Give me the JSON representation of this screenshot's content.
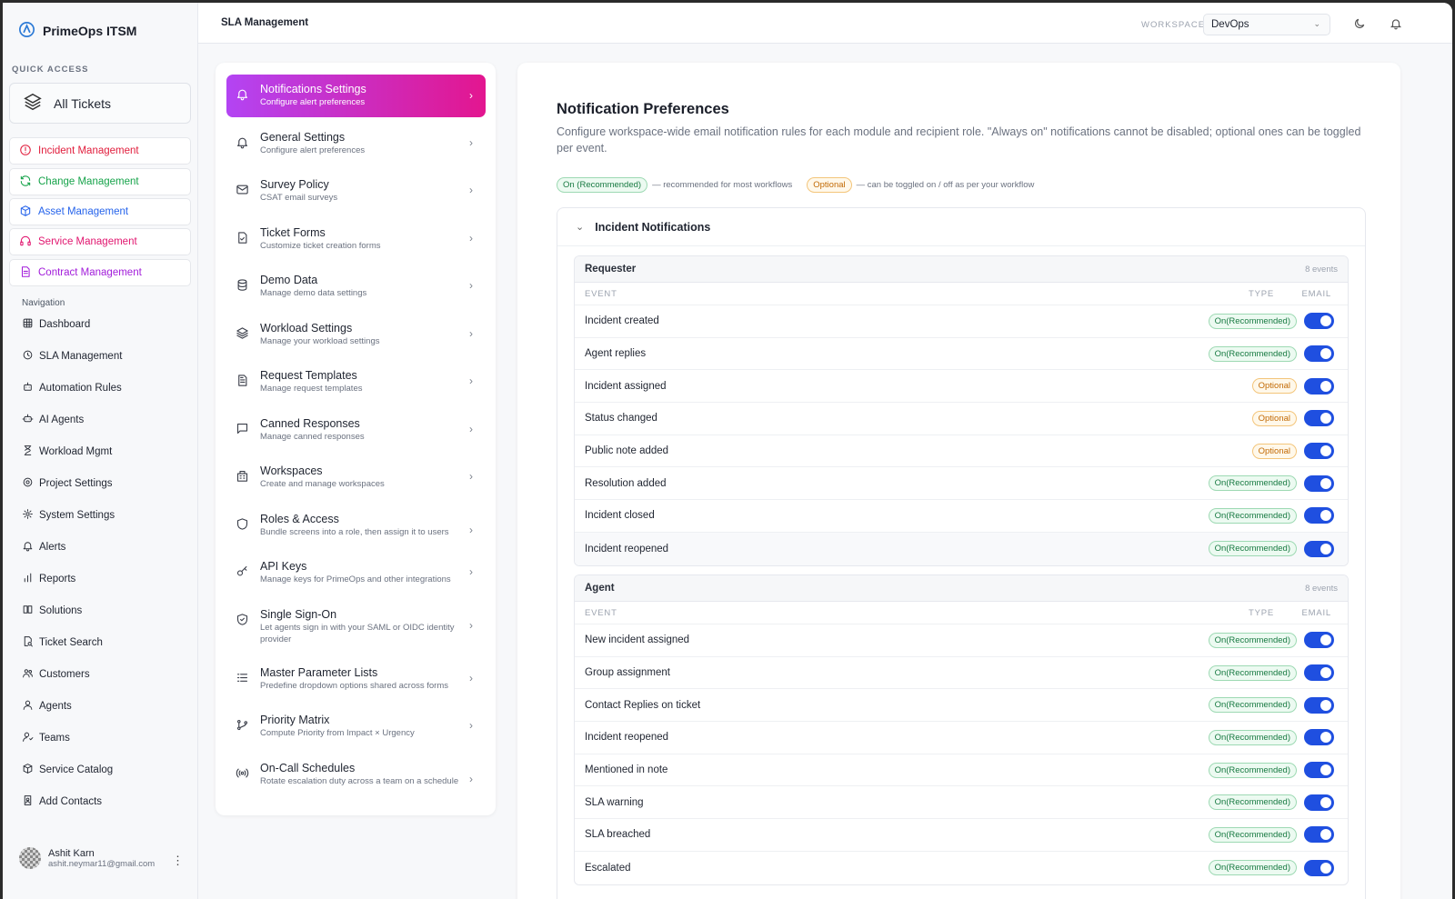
{
  "app": {
    "name": "PrimeOps ITSM"
  },
  "sidebar": {
    "quick_access_label": "QUICK ACCESS",
    "all_tickets_label": "All Tickets",
    "modules": [
      {
        "label": "Incident Management",
        "color": "#e11d3c",
        "icon": "alert-circle-icon"
      },
      {
        "label": "Change Management",
        "color": "#16a34a",
        "icon": "refresh-icon"
      },
      {
        "label": "Asset Management",
        "color": "#2563eb",
        "icon": "cube-icon"
      },
      {
        "label": "Service Management",
        "color": "#e1166f",
        "icon": "headset-icon"
      },
      {
        "label": "Contract Management",
        "color": "#a21cda",
        "icon": "document-icon"
      }
    ],
    "nav_label": "Navigation",
    "nav_items": [
      {
        "label": "Dashboard",
        "icon": "grid-icon"
      },
      {
        "label": "SLA Management",
        "icon": "clock-icon"
      },
      {
        "label": "Automation Rules",
        "icon": "robot-icon"
      },
      {
        "label": "AI Agents",
        "icon": "bot-icon"
      },
      {
        "label": "Workload Mgmt",
        "icon": "hourglass-icon"
      },
      {
        "label": "Project Settings",
        "icon": "gear-icon"
      },
      {
        "label": "System Settings",
        "icon": "cog-icon"
      },
      {
        "label": "Alerts",
        "icon": "bell-icon"
      },
      {
        "label": "Reports",
        "icon": "bar-chart-icon"
      },
      {
        "label": "Solutions",
        "icon": "book-icon"
      },
      {
        "label": "Ticket Search",
        "icon": "file-search-icon"
      },
      {
        "label": "Customers",
        "icon": "users-icon"
      },
      {
        "label": "Agents",
        "icon": "user-icon"
      },
      {
        "label": "Teams",
        "icon": "user-group-icon"
      },
      {
        "label": "Service Catalog",
        "icon": "box-icon"
      },
      {
        "label": "Add Contacts",
        "icon": "contact-icon"
      }
    ],
    "user": {
      "name": "Ashit Karn",
      "email": "ashit.neymar11@gmail.com"
    }
  },
  "topbar": {
    "title": "SLA Management",
    "workspace_label": "WORKSPACE",
    "workspace_value": "DevOps"
  },
  "settings_menu": [
    {
      "title": "Notifications Settings",
      "subtitle": "Configure alert preferences",
      "icon": "bell-icon",
      "active": true
    },
    {
      "title": "General Settings",
      "subtitle": "Configure alert preferences",
      "icon": "bell-icon"
    },
    {
      "title": "Survey Policy",
      "subtitle": "CSAT email surveys",
      "icon": "mail-icon"
    },
    {
      "title": "Ticket Forms",
      "subtitle": "Customize ticket creation forms",
      "icon": "form-icon"
    },
    {
      "title": "Demo Data",
      "subtitle": "Manage demo data settings",
      "icon": "database-icon"
    },
    {
      "title": "Workload Settings",
      "subtitle": "Manage your workload settings",
      "icon": "layers-icon"
    },
    {
      "title": "Request Templates",
      "subtitle": "Manage request templates",
      "icon": "file-text-icon"
    },
    {
      "title": "Canned Responses",
      "subtitle": "Manage canned responses",
      "icon": "message-icon"
    },
    {
      "title": "Workspaces",
      "subtitle": "Create and manage workspaces",
      "icon": "building-icon"
    },
    {
      "title": "Roles & Access",
      "subtitle": "Bundle screens into a role, then assign it to users",
      "icon": "shield-icon"
    },
    {
      "title": "API Keys",
      "subtitle": "Manage keys for PrimeOps and other integrations",
      "icon": "key-icon"
    },
    {
      "title": "Single Sign-On",
      "subtitle": "Let agents sign in with your SAML or OIDC identity provider",
      "icon": "shield-check-icon"
    },
    {
      "title": "Master Parameter Lists",
      "subtitle": "Predefine dropdown options shared across forms",
      "icon": "list-icon"
    },
    {
      "title": "Priority Matrix",
      "subtitle": "Compute Priority from Impact × Urgency",
      "icon": "branch-icon"
    },
    {
      "title": "On-Call Schedules",
      "subtitle": "Rotate escalation duty across a team on a schedule",
      "icon": "broadcast-icon"
    }
  ],
  "main": {
    "title": "Notification Preferences",
    "description": "Configure workspace-wide email notification rules for each module and recipient role. \"Always on\" notifications cannot be disabled; optional ones can be toggled per event.",
    "legend": {
      "on_pill": "On (Recommended)",
      "on_text": "— recommended for most workflows",
      "optional_pill": "Optional",
      "optional_text": "— can be toggled on / off as per your workflow"
    },
    "section_title": "Incident Notifications",
    "col_event": "EVENT",
    "col_type": "TYPE",
    "col_email": "EMAIL",
    "groups": [
      {
        "name": "Requester",
        "count": "8 events",
        "rows": [
          {
            "event": "Incident created",
            "type": "On(Recommended)",
            "kind": "on",
            "email": true
          },
          {
            "event": "Agent replies",
            "type": "On(Recommended)",
            "kind": "on",
            "email": true
          },
          {
            "event": "Incident assigned",
            "type": "Optional",
            "kind": "opt",
            "email": true
          },
          {
            "event": "Status changed",
            "type": "Optional",
            "kind": "opt",
            "email": true
          },
          {
            "event": "Public note added",
            "type": "Optional",
            "kind": "opt",
            "email": true
          },
          {
            "event": "Resolution added",
            "type": "On(Recommended)",
            "kind": "on",
            "email": true
          },
          {
            "event": "Incident closed",
            "type": "On(Recommended)",
            "kind": "on",
            "email": true
          },
          {
            "event": "Incident reopened",
            "type": "On(Recommended)",
            "kind": "on",
            "email": true
          }
        ]
      },
      {
        "name": "Agent",
        "count": "8 events",
        "rows": [
          {
            "event": "New incident assigned",
            "type": "On(Recommended)",
            "kind": "on",
            "email": true
          },
          {
            "event": "Group assignment",
            "type": "On(Recommended)",
            "kind": "on",
            "email": true
          },
          {
            "event": "Contact Replies on ticket",
            "type": "On(Recommended)",
            "kind": "on",
            "email": true
          },
          {
            "event": "Incident reopened",
            "type": "On(Recommended)",
            "kind": "on",
            "email": true
          },
          {
            "event": "Mentioned in note",
            "type": "On(Recommended)",
            "kind": "on",
            "email": true
          },
          {
            "event": "SLA warning",
            "type": "On(Recommended)",
            "kind": "on",
            "email": true
          },
          {
            "event": "SLA breached",
            "type": "On(Recommended)",
            "kind": "on",
            "email": true
          },
          {
            "event": "Escalated",
            "type": "On(Recommended)",
            "kind": "on",
            "email": true
          }
        ]
      }
    ]
  }
}
